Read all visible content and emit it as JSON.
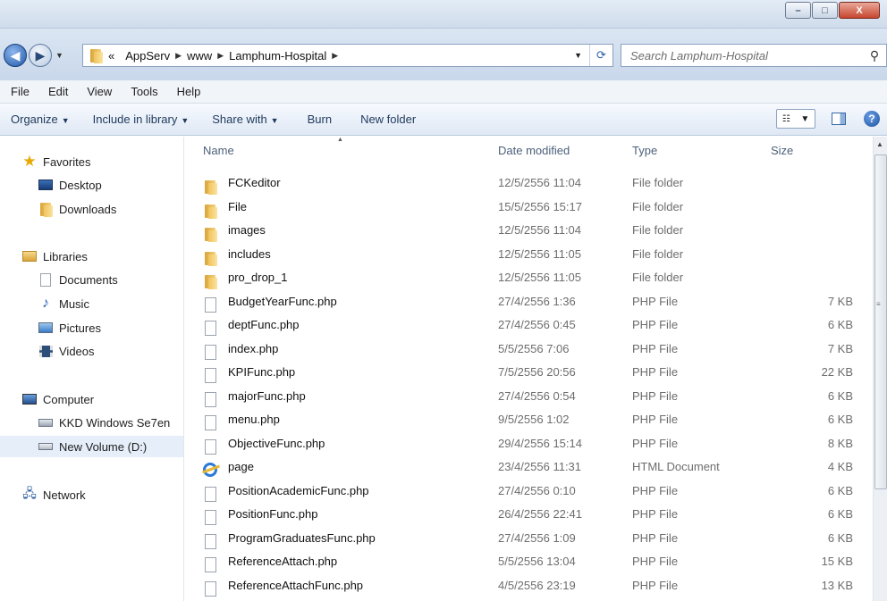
{
  "window": {
    "minimize_glyph": "–",
    "maximize_glyph": "□",
    "close_glyph": "X"
  },
  "address": {
    "overflow": "«",
    "crumbs": [
      "AppServ",
      "www",
      "Lamphum-Hospital"
    ],
    "search_placeholder": "Search Lamphum-Hospital"
  },
  "menu": [
    "File",
    "Edit",
    "View",
    "Tools",
    "Help"
  ],
  "toolbar": {
    "organize": "Organize",
    "include": "Include in library",
    "share": "Share with",
    "burn": "Burn",
    "new_folder": "New folder"
  },
  "nav": {
    "favorites": "Favorites",
    "desktop": "Desktop",
    "downloads": "Downloads",
    "libraries": "Libraries",
    "documents": "Documents",
    "music": "Music",
    "pictures": "Pictures",
    "videos": "Videos",
    "computer": "Computer",
    "drive_c": "KKD Windows Se7en",
    "drive_d": "New Volume (D:)",
    "network": "Network"
  },
  "columns": {
    "name": "Name",
    "date": "Date modified",
    "type": "Type",
    "size": "Size"
  },
  "files": [
    {
      "name": "FCKeditor",
      "date": "12/5/2556 11:04",
      "type": "File folder",
      "size": "",
      "icon": "folder-icon"
    },
    {
      "name": "File",
      "date": "15/5/2556 15:17",
      "type": "File folder",
      "size": "",
      "icon": "folder-icon"
    },
    {
      "name": "images",
      "date": "12/5/2556 11:04",
      "type": "File folder",
      "size": "",
      "icon": "folder-icon"
    },
    {
      "name": "includes",
      "date": "12/5/2556 11:05",
      "type": "File folder",
      "size": "",
      "icon": "folder-icon"
    },
    {
      "name": "pro_drop_1",
      "date": "12/5/2556 11:05",
      "type": "File folder",
      "size": "",
      "icon": "folder-icon"
    },
    {
      "name": "BudgetYearFunc.php",
      "date": "27/4/2556 1:36",
      "type": "PHP File",
      "size": "7 KB",
      "icon": "file-icon"
    },
    {
      "name": "deptFunc.php",
      "date": "27/4/2556 0:45",
      "type": "PHP File",
      "size": "6 KB",
      "icon": "file-icon"
    },
    {
      "name": "index.php",
      "date": "5/5/2556 7:06",
      "type": "PHP File",
      "size": "7 KB",
      "icon": "file-icon"
    },
    {
      "name": "KPIFunc.php",
      "date": "7/5/2556 20:56",
      "type": "PHP File",
      "size": "22 KB",
      "icon": "file-icon"
    },
    {
      "name": "majorFunc.php",
      "date": "27/4/2556 0:54",
      "type": "PHP File",
      "size": "6 KB",
      "icon": "file-icon"
    },
    {
      "name": "menu.php",
      "date": "9/5/2556 1:02",
      "type": "PHP File",
      "size": "6 KB",
      "icon": "file-icon"
    },
    {
      "name": "ObjectiveFunc.php",
      "date": "29/4/2556 15:14",
      "type": "PHP File",
      "size": "8 KB",
      "icon": "file-icon"
    },
    {
      "name": "page",
      "date": "23/4/2556 11:31",
      "type": "HTML Document",
      "size": "4 KB",
      "icon": "ie-icon"
    },
    {
      "name": "PositionAcademicFunc.php",
      "date": "27/4/2556 0:10",
      "type": "PHP File",
      "size": "6 KB",
      "icon": "file-icon"
    },
    {
      "name": "PositionFunc.php",
      "date": "26/4/2556 22:41",
      "type": "PHP File",
      "size": "6 KB",
      "icon": "file-icon"
    },
    {
      "name": "ProgramGraduatesFunc.php",
      "date": "27/4/2556 1:09",
      "type": "PHP File",
      "size": "6 KB",
      "icon": "file-icon"
    },
    {
      "name": "ReferenceAttach.php",
      "date": "5/5/2556 13:04",
      "type": "PHP File",
      "size": "15 KB",
      "icon": "file-icon"
    },
    {
      "name": "ReferenceAttachFunc.php",
      "date": "4/5/2556 23:19",
      "type": "PHP File",
      "size": "13 KB",
      "icon": "file-icon"
    }
  ]
}
